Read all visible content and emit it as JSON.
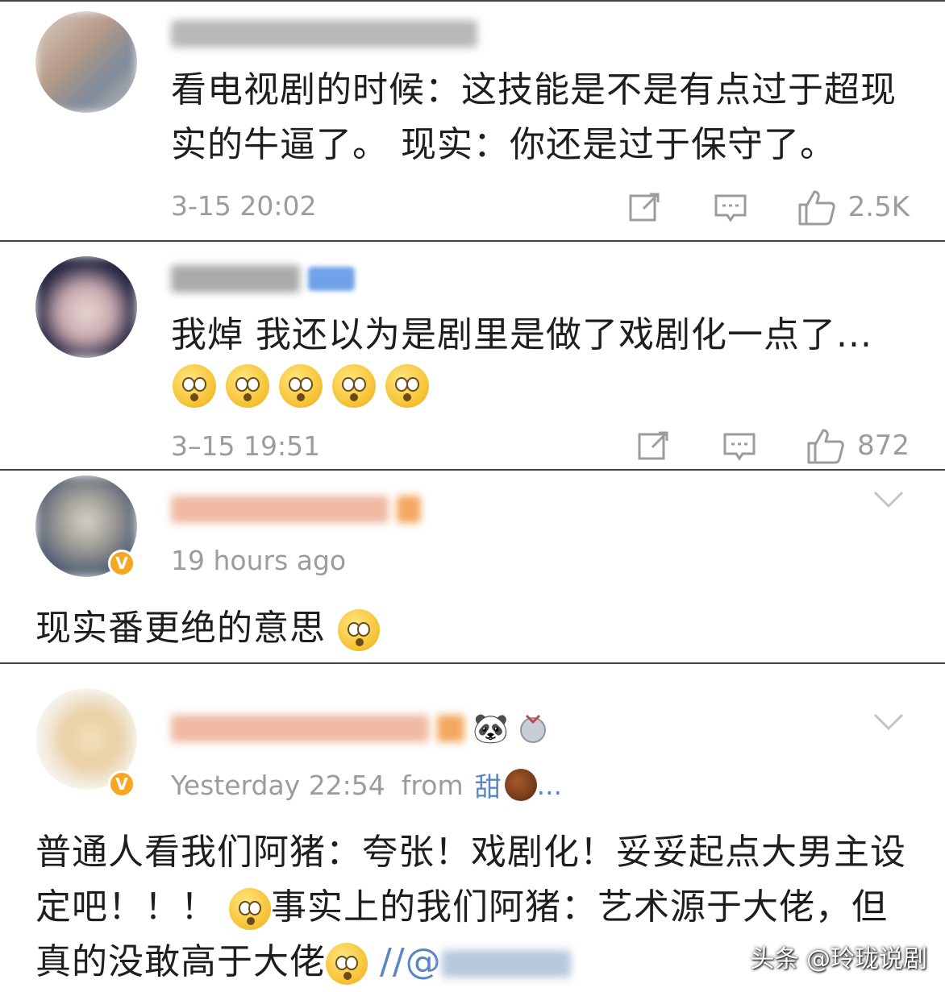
{
  "comments": [
    {
      "text": "看电视剧的时候：这技能是不是有点过于超现实的牛逼了。 现实：你还是过于保守了。",
      "time": "3-15 20:02",
      "likes": "2.5K"
    },
    {
      "text": "我焯  我还以为是剧里是做了戏剧化一点了...",
      "emoji_count": 5,
      "emoji_name": "flushed-tearful-emoji",
      "time": "3–15 19:51",
      "likes": "872"
    },
    {
      "time": "19 hours ago",
      "text": "现实番更绝的意思",
      "badge": "V"
    },
    {
      "time": "Yesterday 22:54",
      "from_label": "from",
      "from_value": "甜",
      "ellipsis": "...",
      "badge": "V",
      "text_part1": "普通人看我们阿猪：夸张！戏剧化！妥妥起点大男主设定吧！！！ ",
      "text_part2": "事实上的我们阿猪：艺术源于大佬，但真的没敢高于大佬",
      "text_part3": "//@",
      "panda": "🐼"
    }
  ],
  "watermark": "头条 @玲珑说剧",
  "colors": {
    "meta": "#9c9c9c",
    "mention": "#5a86c5",
    "badge": "#f5a623",
    "divider": "#444444"
  },
  "icons": [
    "repost-icon",
    "comment-icon",
    "like-icon",
    "chevron-down-icon",
    "verified-badge-icon"
  ]
}
